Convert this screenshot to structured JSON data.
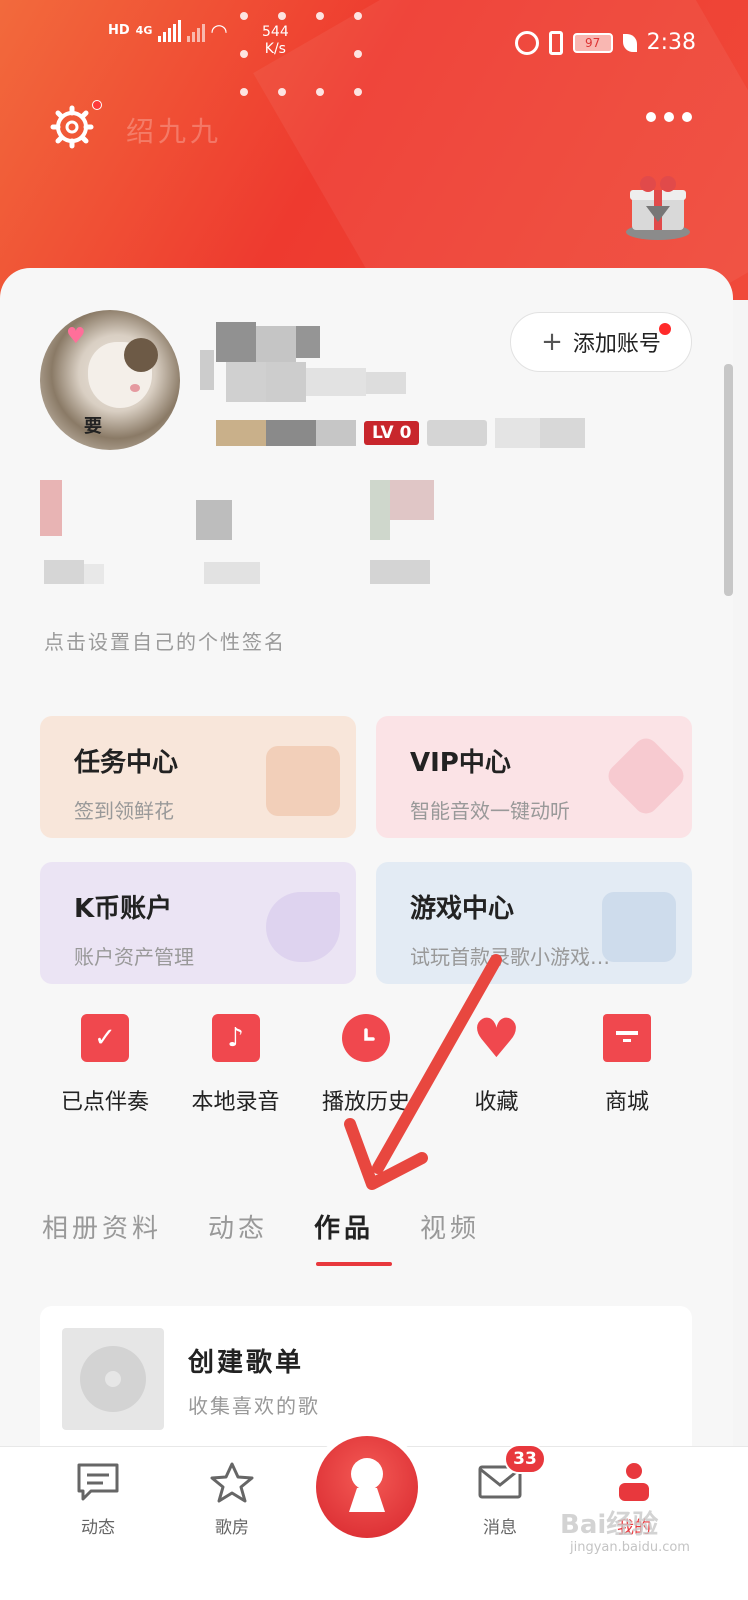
{
  "status_bar": {
    "network_labels": [
      "HD",
      "4G"
    ],
    "net_speed": "544",
    "net_unit": "K/s",
    "battery": "97",
    "time": "2:38"
  },
  "header": {
    "title": "绍九九"
  },
  "profile": {
    "add_account_label": "添加账号",
    "avatar_text": "要",
    "level_badge": "LV 0",
    "bio_placeholder": "点击设置自己的个性签名"
  },
  "features": [
    {
      "title": "任务中心",
      "subtitle": "签到领鲜花"
    },
    {
      "title": "VIP中心",
      "subtitle": "智能音效一键动听"
    },
    {
      "title": "K币账户",
      "subtitle": "账户资产管理"
    },
    {
      "title": "游戏中心",
      "subtitle": "试玩首款录歌小游戏…"
    }
  ],
  "quick_actions": [
    {
      "label": "已点伴奏",
      "icon": "checkbox-icon"
    },
    {
      "label": "本地录音",
      "icon": "music-note-icon"
    },
    {
      "label": "播放历史",
      "icon": "clock-icon"
    },
    {
      "label": "收藏",
      "icon": "heart-icon"
    },
    {
      "label": "商城",
      "icon": "shop-icon"
    }
  ],
  "tabs": [
    {
      "label": "相册资料"
    },
    {
      "label": "动态"
    },
    {
      "label": "作品"
    },
    {
      "label": "视频"
    }
  ],
  "playlist": {
    "title": "创建歌单",
    "subtitle": "收集喜欢的歌"
  },
  "bottom_nav": {
    "items": [
      {
        "label": "动态"
      },
      {
        "label": "歌房"
      },
      {
        "label": "消息"
      },
      {
        "label": "我的"
      }
    ],
    "message_badge": "33"
  },
  "watermark": {
    "brand": "Bai经验",
    "url": "jingyan.baidu.com"
  },
  "colors": {
    "accent": "#e8383d",
    "header_gradient_start": "#f26a3c",
    "header_gradient_end": "#ee3a2f"
  }
}
